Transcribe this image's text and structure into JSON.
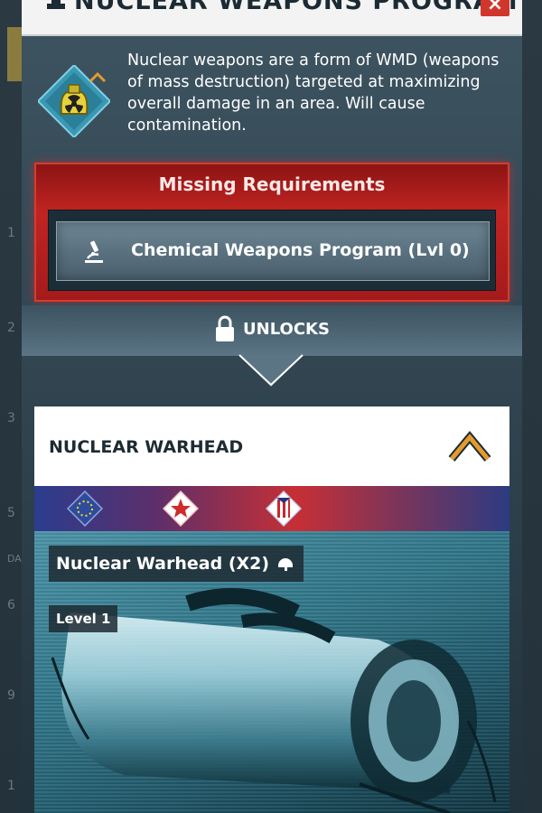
{
  "modal": {
    "title": "NUCLEAR WEAPONS PROGRAM",
    "close_label": "×",
    "description": "Nuclear weapons are a form of WMD (weapons of mass destruction) targeted at maximizing overall damage in an area. Will cause contamination."
  },
  "requirements": {
    "title": "Missing Requirements",
    "items": [
      {
        "label": "Chemical Weapons Program (Lvl 0)",
        "icon": "microscope-icon"
      }
    ]
  },
  "unlocks": {
    "label": "UNLOCKS"
  },
  "unlock_card": {
    "title": "NUCLEAR WARHEAD",
    "item_name": "Nuclear Warhead (X2)",
    "level": "Level 1",
    "factions": [
      "european-faction-icon",
      "asian-faction-icon",
      "american-faction-icon"
    ]
  },
  "background": {
    "ticks": [
      "1",
      "2",
      "3",
      "5",
      "6",
      "9",
      "1"
    ],
    "day_label": "DA"
  },
  "colors": {
    "accent_red": "#c02421",
    "card_bg": "#ffffff",
    "modal_bg": "#334753",
    "chevron_orange": "#e39b2e"
  }
}
